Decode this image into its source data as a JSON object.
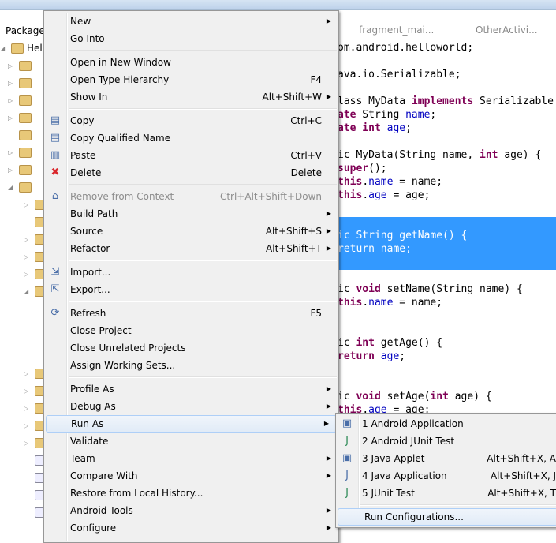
{
  "left_panel": {
    "title": "Package",
    "project": "Hell"
  },
  "editor_tabs": [
    "fragment_mai...",
    "OtherActivi..."
  ],
  "code_lines": [
    [
      [
        "t",
        "om.android.helloworld;"
      ]
    ],
    [],
    [
      [
        "t",
        "ava.io.Serializable;"
      ]
    ],
    [],
    [
      [
        "t",
        "lass MyData "
      ],
      [
        "k",
        "implements"
      ],
      [
        "t",
        " Serializable"
      ]
    ],
    [
      [
        "k",
        "ate"
      ],
      [
        "t",
        " String "
      ],
      [
        "f",
        "name"
      ],
      [
        "t",
        ";"
      ]
    ],
    [
      [
        "k",
        "ate int"
      ],
      [
        "t",
        " "
      ],
      [
        "f",
        "age"
      ],
      [
        "t",
        ";"
      ]
    ],
    [],
    [
      [
        "t",
        "ic MyData(String name, "
      ],
      [
        "k",
        "int"
      ],
      [
        "t",
        " age) {"
      ]
    ],
    [
      [
        "k",
        "super"
      ],
      [
        "t",
        "();"
      ]
    ],
    [
      [
        "k",
        "this"
      ],
      [
        "t",
        "."
      ],
      [
        "f",
        "name"
      ],
      [
        "t",
        " = name;"
      ]
    ],
    [
      [
        "k",
        "this"
      ],
      [
        "t",
        "."
      ],
      [
        "f",
        "age"
      ],
      [
        "t",
        " = age;"
      ]
    ],
    [],
    [],
    [
      [
        "s",
        "ic String getName() {"
      ]
    ],
    [
      [
        "s",
        "return name;"
      ]
    ],
    [],
    [],
    [
      [
        "t",
        "ic "
      ],
      [
        "k",
        "void"
      ],
      [
        "t",
        " setName(String name) {"
      ]
    ],
    [
      [
        "k",
        "this"
      ],
      [
        "t",
        "."
      ],
      [
        "f",
        "name"
      ],
      [
        "t",
        " = name;"
      ]
    ],
    [],
    [],
    [
      [
        "t",
        "ic "
      ],
      [
        "k",
        "int"
      ],
      [
        "t",
        " getAge() {"
      ]
    ],
    [
      [
        "k",
        "return"
      ],
      [
        "t",
        " "
      ],
      [
        "f",
        "age"
      ],
      [
        "t",
        ";"
      ]
    ],
    [],
    [],
    [
      [
        "t",
        "ic "
      ],
      [
        "k",
        "void"
      ],
      [
        "t",
        " setAge("
      ],
      [
        "k",
        "int"
      ],
      [
        "t",
        " age) {"
      ]
    ],
    [
      [
        "k",
        "this"
      ],
      [
        "t",
        "."
      ],
      [
        "f",
        "age"
      ],
      [
        "t",
        " = age;"
      ]
    ]
  ],
  "context_menu": [
    {
      "label": "New",
      "submenu": true
    },
    {
      "label": "Go Into"
    },
    {
      "sep": true
    },
    {
      "label": "Open in New Window"
    },
    {
      "label": "Open Type Hierarchy",
      "shortcut": "F4"
    },
    {
      "label": "Show In",
      "shortcut": "Alt+Shift+W",
      "submenu": true
    },
    {
      "sep": true
    },
    {
      "label": "Copy",
      "shortcut": "Ctrl+C",
      "icon": "copy-icon"
    },
    {
      "label": "Copy Qualified Name",
      "icon": "copy-qualified-name-icon"
    },
    {
      "label": "Paste",
      "shortcut": "Ctrl+V",
      "icon": "paste-icon"
    },
    {
      "label": "Delete",
      "shortcut": "Delete",
      "icon": "delete-icon"
    },
    {
      "sep": true
    },
    {
      "label": "Remove from Context",
      "shortcut": "Ctrl+Alt+Shift+Down",
      "disabled": true,
      "icon": "remove-context-icon"
    },
    {
      "label": "Build Path",
      "submenu": true
    },
    {
      "label": "Source",
      "shortcut": "Alt+Shift+S",
      "submenu": true
    },
    {
      "label": "Refactor",
      "shortcut": "Alt+Shift+T",
      "submenu": true
    },
    {
      "sep": true
    },
    {
      "label": "Import...",
      "icon": "import-icon"
    },
    {
      "label": "Export...",
      "icon": "export-icon"
    },
    {
      "sep": true
    },
    {
      "label": "Refresh",
      "shortcut": "F5",
      "icon": "refresh-icon"
    },
    {
      "label": "Close Project"
    },
    {
      "label": "Close Unrelated Projects"
    },
    {
      "label": "Assign Working Sets..."
    },
    {
      "sep": true
    },
    {
      "label": "Profile As",
      "submenu": true
    },
    {
      "label": "Debug As",
      "submenu": true
    },
    {
      "label": "Run As",
      "submenu": true,
      "active": true
    },
    {
      "label": "Validate"
    },
    {
      "label": "Team",
      "submenu": true
    },
    {
      "label": "Compare With",
      "submenu": true
    },
    {
      "label": "Restore from Local History..."
    },
    {
      "label": "Android Tools",
      "submenu": true
    },
    {
      "label": "Configure",
      "submenu": true
    }
  ],
  "run_as_submenu": [
    {
      "label": "1 Android Application",
      "icon": "android-application-icon"
    },
    {
      "label": "2 Android JUnit Test",
      "icon": "android-junit-icon"
    },
    {
      "label": "3 Java Applet",
      "shortcut": "Alt+Shift+X, A",
      "icon": "java-applet-icon"
    },
    {
      "label": "4 Java Application",
      "shortcut": "Alt+Shift+X, J",
      "icon": "java-application-icon"
    },
    {
      "label": "5 JUnit Test",
      "shortcut": "Alt+Shift+X, T",
      "icon": "junit-icon"
    },
    {
      "sep": true
    },
    {
      "label": "Run Configurations...",
      "active": true
    }
  ],
  "icons": {
    "copy-icon": "▤",
    "copy-qualified-name-icon": "▤",
    "paste-icon": "▥",
    "delete-icon": "✖",
    "remove-context-icon": "⌂",
    "import-icon": "⇲",
    "export-icon": "⇱",
    "refresh-icon": "⟳",
    "android-application-icon": "▣",
    "android-junit-icon": "J",
    "java-applet-icon": "▣",
    "java-application-icon": "J",
    "junit-icon": "J"
  },
  "colors": {
    "selection": "#3399ff",
    "keyword": "#7f0055",
    "field": "#0000c0",
    "delete": "#d9262b",
    "junit": "#2e8b57"
  }
}
